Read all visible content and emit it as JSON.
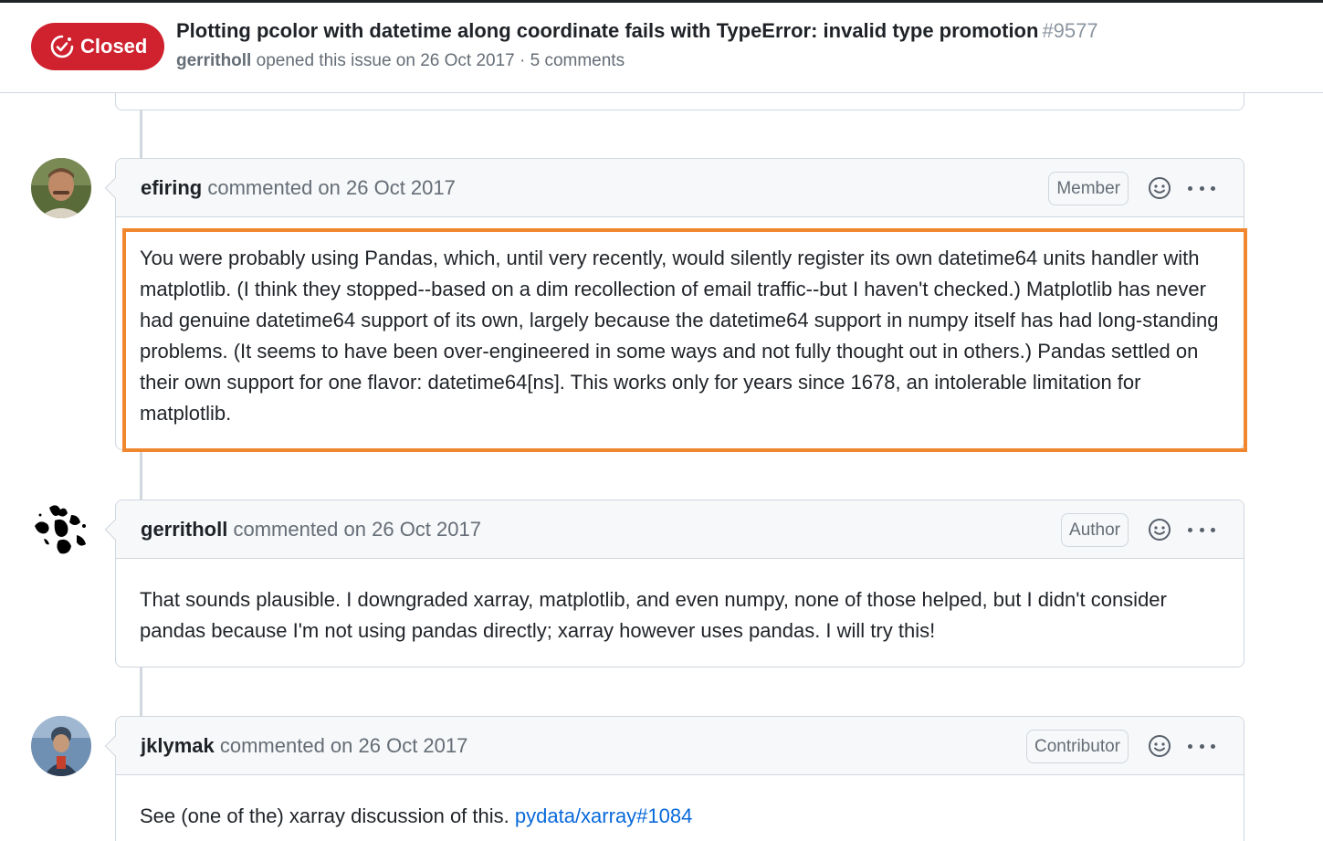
{
  "issue": {
    "state": "Closed",
    "title": "Plotting pcolor with datetime along coordinate fails with TypeError: invalid type promotion",
    "number": "#9577",
    "author": "gerritholl",
    "meta": "opened this issue on 26 Oct 2017 · 5 comments"
  },
  "comments": [
    {
      "user": "efiring",
      "action": "commented on 26 Oct 2017",
      "role": "Member",
      "body": "You were probably using Pandas, which, until very recently, would silently register its own datetime64 units handler with matplotlib. (I think they stopped--based on a dim recollection of email traffic--but I haven't checked.) Matplotlib has never had genuine datetime64 support of its own, largely because the datetime64 support in numpy itself has had long-standing problems. (It seems to have been over-engineered in some ways and not fully thought out in others.) Pandas settled on their own support for one flavor: datetime64[ns]. This works only for years since 1678, an intolerable limitation for matplotlib."
    },
    {
      "user": "gerritholl",
      "action": "commented on 26 Oct 2017",
      "role": "Author",
      "body": "That sounds plausible. I downgraded xarray, matplotlib, and even numpy, none of those helped, but I didn't consider pandas because I'm not using pandas directly; xarray however uses pandas. I will try this!"
    },
    {
      "user": "jklymak",
      "action": "commented on 26 Oct 2017",
      "role": "Contributor",
      "body_prefix": "See (one of the) xarray discussion of this.",
      "link": "pydata/xarray#1084"
    }
  ],
  "colors": {
    "closed": "#cf222e",
    "highlight": "#f0862d",
    "link": "#0969da"
  }
}
